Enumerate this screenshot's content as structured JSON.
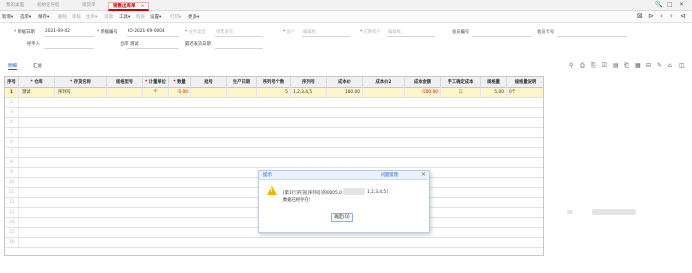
{
  "tabs": [
    {
      "label": "我的桌面",
      "active": false
    },
    {
      "label": "初始化导航",
      "active": false
    },
    {
      "label": "销货单",
      "active": false
    },
    {
      "label": "销售出库单",
      "active": true
    }
  ],
  "tab_close": "×",
  "window_controls": {
    "search": "🔍",
    "restore": "□",
    "close": "✕"
  },
  "toolbar": {
    "items": [
      "新增▾",
      "选单▾",
      "保存▾",
      "删除",
      "审核",
      "生单▾",
      "资源",
      "工具▾",
      "附表",
      "设置▾",
      "打印▾",
      "更多▾"
    ],
    "right": [
      "⊠",
      "⊳",
      "‹",
      "›",
      "⊲"
    ]
  },
  "form": {
    "row1": [
      {
        "label": "单据日期",
        "required": true,
        "value": "2021-09-02"
      },
      {
        "label": "单据编号",
        "required": true,
        "value": "IO-2021-09-0004"
      },
      {
        "label": "业务类型",
        "required": true,
        "value": "销售退货",
        "placeholder": true
      },
      {
        "label": "客户",
        "required": true,
        "value": "编辑框",
        "placeholder": true
      },
      {
        "label": "结算客户",
        "required": true,
        "value": "编辑框",
        "placeholder": true
      },
      {
        "label": "会员编号",
        "required": false,
        "value": ""
      },
      {
        "label": "会员卡号",
        "required": false,
        "value": ""
      }
    ],
    "row2": [
      {
        "label": "经手人",
        "value": ""
      },
      {
        "label": "仓库",
        "value": "测试"
      },
      {
        "label": "最迟发货日期",
        "value": ""
      }
    ]
  },
  "subtabs": [
    "明细",
    "汇总"
  ],
  "grid_icons": [
    "⚲",
    "⎙",
    "⎘",
    "⎚",
    "▤",
    "⎗",
    "▦",
    "⊟",
    "✎",
    "⌂",
    "◫"
  ],
  "grid": {
    "columns": [
      "序号",
      "仓库",
      "存货名称",
      "规格型号",
      "计量单位",
      "数量",
      "批号",
      "生产日期",
      "序列号个数",
      "序列号",
      "成本价",
      "成本价2",
      "成本金额",
      "手工确定成本",
      "规格量",
      "规格量说明"
    ],
    "rows": [
      {
        "num": "1",
        "cells": [
          "测试",
          "序列号",
          "",
          "个",
          "-5.00",
          "",
          "",
          "5",
          "1,2,3,4,5",
          "100.00",
          "",
          "-500.00",
          "☐",
          "5.00",
          "0个"
        ]
      }
    ],
    "row_numbers": [
      "1",
      "2",
      "3",
      "4",
      "5",
      "6",
      "7",
      "8",
      "9",
      "10",
      "11",
      "12",
      "13",
      "14",
      "15",
      "16"
    ]
  },
  "dialog": {
    "title": "提示",
    "link": "问题反馈",
    "close": "×",
    "message_line1": "[第1行]存货[序列号]的0005,0",
    "message_line1_tail": "1,2,3,4,5]",
    "message_line2": "数据已经存在!",
    "ok_label": "确定(O)"
  }
}
